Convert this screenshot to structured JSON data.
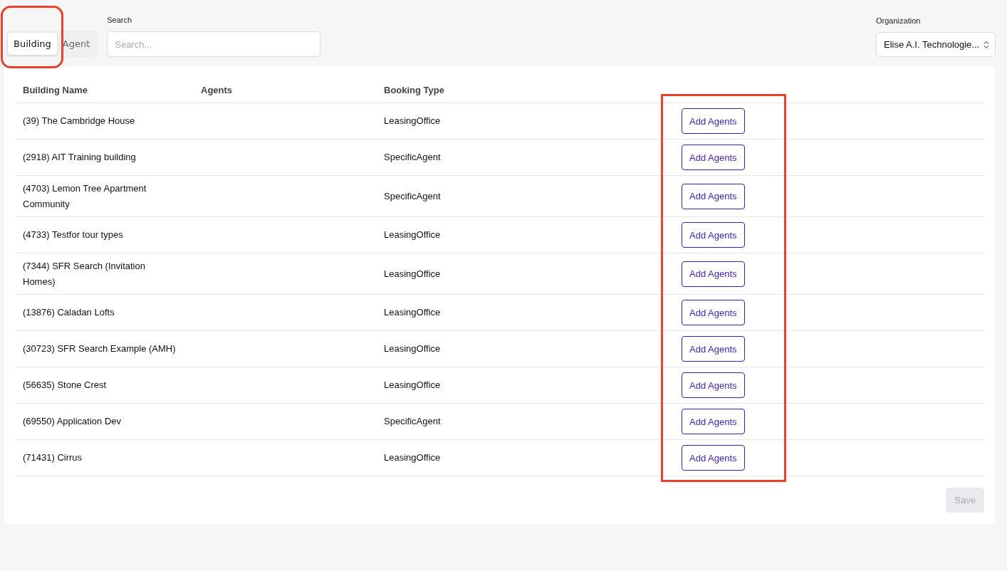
{
  "tabs": [
    {
      "label": "Building",
      "selected": true
    },
    {
      "label": "Agent",
      "selected": false
    }
  ],
  "search": {
    "label": "Search",
    "placeholder": "Search..."
  },
  "organization": {
    "label": "Organization",
    "value": "Elise A.I. Technologie..."
  },
  "table": {
    "columns": [
      "Building Name",
      "Agents",
      "Booking Type"
    ],
    "rows": [
      {
        "building_name": "(39) The Cambridge House",
        "booking_type": "LeasingOffice",
        "action": "Add Agents"
      },
      {
        "building_name": "(2918) AIT Training building",
        "booking_type": "SpecificAgent",
        "action": "Add Agents"
      },
      {
        "building_name": "(4703) Lemon Tree Apartment Community",
        "booking_type": "SpecificAgent",
        "action": "Add Agents"
      },
      {
        "building_name": "(4733) Testfor tour types",
        "booking_type": "LeasingOffice",
        "action": "Add Agents"
      },
      {
        "building_name": "(7344) SFR Search (Invitation Homes)",
        "booking_type": "LeasingOffice",
        "action": "Add Agents"
      },
      {
        "building_name": "(13876) Caladan Lofts",
        "booking_type": "LeasingOffice",
        "action": "Add Agents"
      },
      {
        "building_name": "(30723) SFR Search Example (AMH)",
        "booking_type": "LeasingOffice",
        "action": "Add Agents"
      },
      {
        "building_name": "(56635) Stone Crest",
        "booking_type": "LeasingOffice",
        "action": "Add Agents"
      },
      {
        "building_name": "(69550) Application Dev",
        "booking_type": "SpecificAgent",
        "action": "Add Agents"
      },
      {
        "building_name": "(71431) Cirrus",
        "booking_type": "LeasingOffice",
        "action": "Add Agents"
      }
    ]
  },
  "save_button": {
    "label": "Save",
    "disabled": true
  }
}
